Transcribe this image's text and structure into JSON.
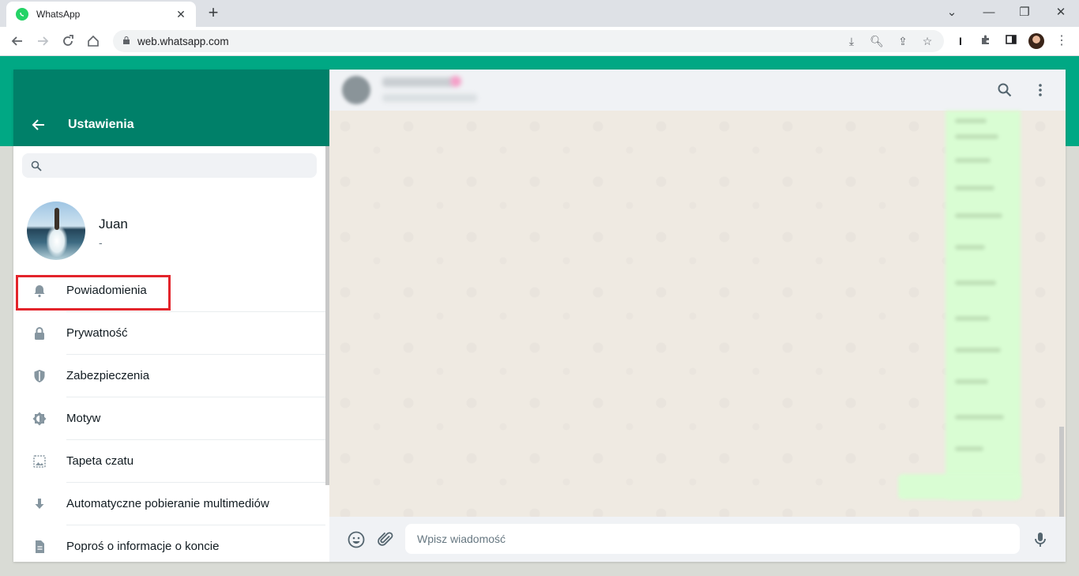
{
  "browser": {
    "tab_title": "WhatsApp",
    "tab_close": "✕",
    "new_tab": "+",
    "url": "web.whatsapp.com",
    "window_controls": {
      "dropdown": "⌄",
      "minimize": "—",
      "restore": "❐",
      "close": "✕"
    },
    "extension_letter": "I"
  },
  "settings": {
    "title": "Ustawienia",
    "search_placeholder": "",
    "profile": {
      "name": "Juan",
      "about": "-"
    },
    "items": [
      {
        "label": "Powiadomienia",
        "icon": "bell-icon"
      },
      {
        "label": "Prywatność",
        "icon": "lock-icon"
      },
      {
        "label": "Zabezpieczenia",
        "icon": "shield-icon"
      },
      {
        "label": "Motyw",
        "icon": "theme-icon"
      },
      {
        "label": "Tapeta czatu",
        "icon": "wallpaper-icon"
      },
      {
        "label": "Automatyczne pobieranie multimediów",
        "icon": "download-icon"
      },
      {
        "label": "Poproś o informacje o koncie",
        "icon": "document-icon"
      }
    ],
    "highlighted_item": "Powiadomienia",
    "highlight_color": "#e3242b"
  },
  "conversation": {
    "composer_placeholder": "Wpisz wiadomość"
  },
  "colors": {
    "brand_green": "#00a884",
    "header_green": "#008069",
    "outgoing_bubble": "#d9fdd3",
    "chat_background": "#efeae2"
  }
}
